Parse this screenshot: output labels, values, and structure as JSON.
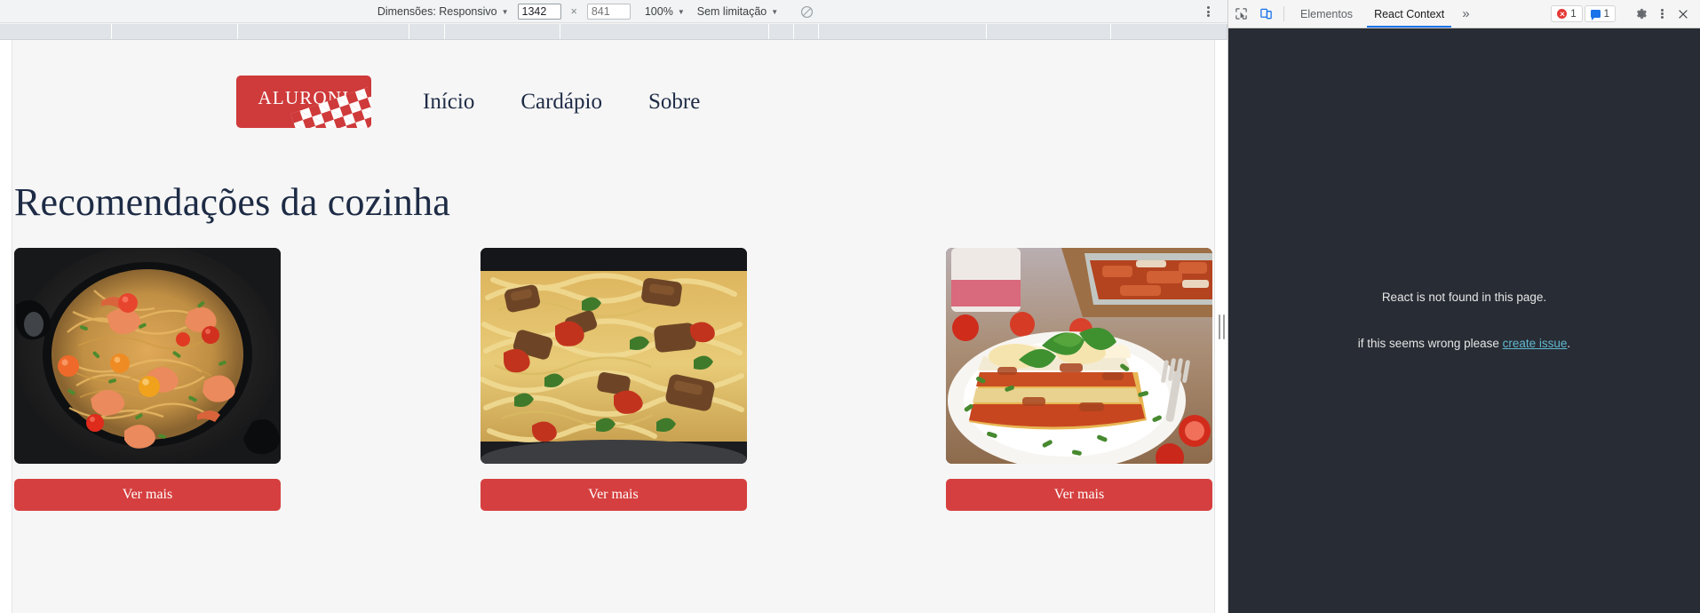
{
  "device_toolbar": {
    "dimensions_label": "Dimensões: Responsivo",
    "width_value": "1342",
    "height_placeholder": "841",
    "times_symbol": "×",
    "zoom_label": "100%",
    "throttling_label": "Sem limitação",
    "throttle_icon": "no-throttling-icon",
    "more_options_icon": "kebab-menu-icon"
  },
  "devtools": {
    "inspect_icon": "inspect-element-icon",
    "device_toggle_icon": "device-toolbar-icon",
    "tabs": [
      {
        "label": "Elementos",
        "active": false
      },
      {
        "label": "React Context",
        "active": true
      }
    ],
    "more_tabs_icon": "chevron-double-right-icon",
    "errors_badge": {
      "icon": "error-circle-icon",
      "count": "1"
    },
    "messages_badge": {
      "icon": "message-box-icon",
      "count": "1"
    },
    "settings_icon": "gear-icon",
    "kebab_icon": "kebab-menu-icon",
    "close_icon": "close-icon",
    "panel": {
      "line1": "React is not found in this page.",
      "line2_prefix": "if this seems wrong please ",
      "line2_link": "create issue",
      "line2_suffix": "."
    }
  },
  "site": {
    "logo_text": "ALURONI",
    "nav": [
      {
        "label": "Início"
      },
      {
        "label": "Cardápio"
      },
      {
        "label": "Sobre"
      }
    ],
    "section_title": "Recomendações da cozinha",
    "cards": [
      {
        "image_name": "shrimp-pasta-photo",
        "button_label": "Ver mais"
      },
      {
        "image_name": "fettuccine-beef-photo",
        "button_label": "Ver mais"
      },
      {
        "image_name": "lasagna-plate-photo",
        "button_label": "Ver mais"
      }
    ]
  },
  "colors": {
    "brand_red": "#cf3a3a",
    "button_red": "#d63f3f",
    "navy_text": "#1d2b45",
    "page_bg": "#f6f6f6",
    "devtools_bg": "#282c34",
    "link_cyan": "#61b8d0",
    "tab_accent": "#1a73e8"
  }
}
